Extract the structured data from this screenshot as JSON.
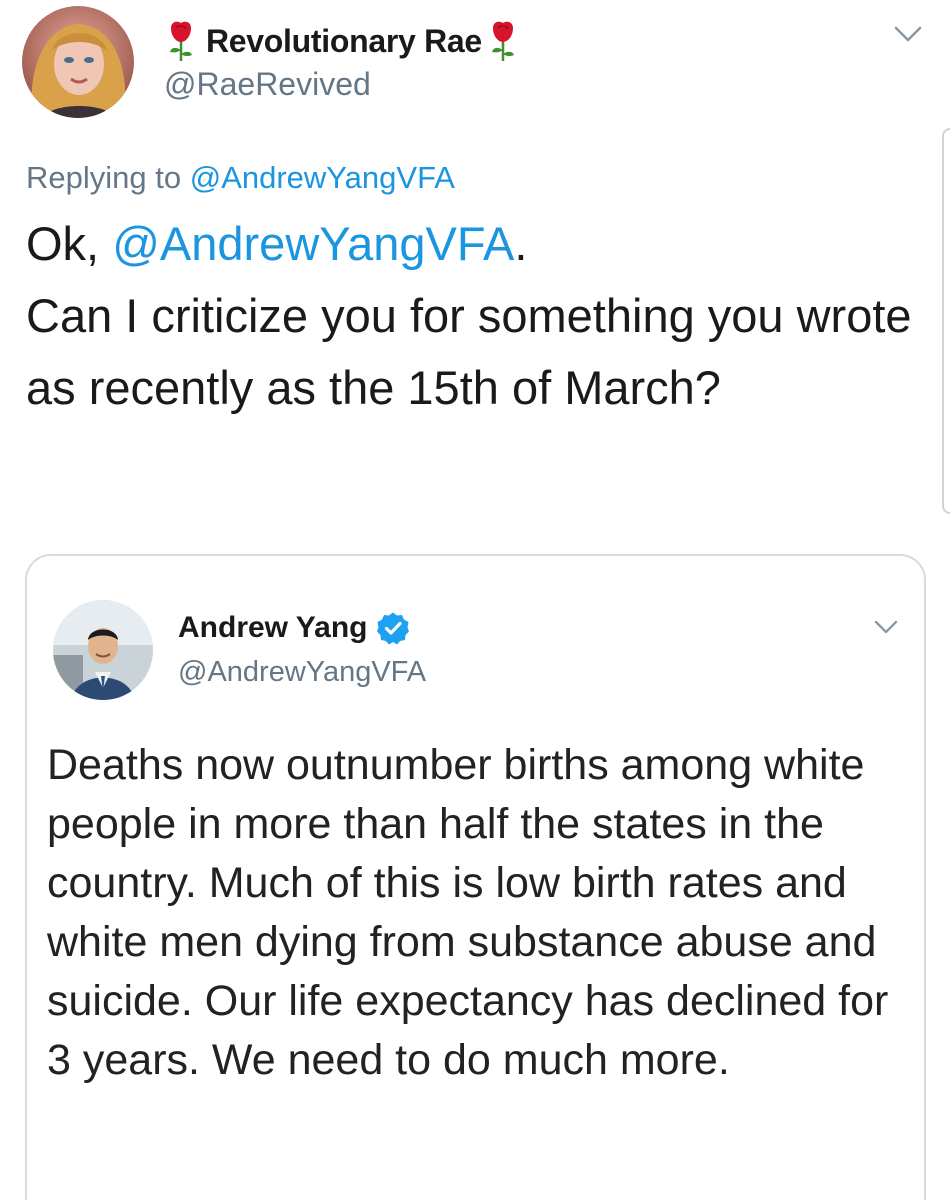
{
  "tweet": {
    "author_name": "Revolutionary Rae",
    "author_handle": "@RaeRevived",
    "replying_prefix": "Replying to",
    "replying_to": "@AndrewYangVFA",
    "text_prefix": "Ok,",
    "text_mention": "@AndrewYangVFA",
    "text_mention_suffix": ".",
    "text_body": "Can I criticize you for something you wrote as recently as the 15th of March?",
    "name_emoji_icon": "rose-icon"
  },
  "quoted_tweet": {
    "author_name": "Andrew Yang",
    "author_handle": "@AndrewYangVFA",
    "verified_icon": "verified-badge-icon",
    "text": "Deaths now outnumber births among white people in more than half the states in the country. Much of this is low birth rates and white men dying from substance abuse and suicide. Our life expectancy has declined for 3 years. We need to do much more."
  },
  "colors": {
    "link": "#1b95e0",
    "secondary_text": "#657786",
    "border": "#d5dbe0",
    "verified": "#1da1f2"
  }
}
